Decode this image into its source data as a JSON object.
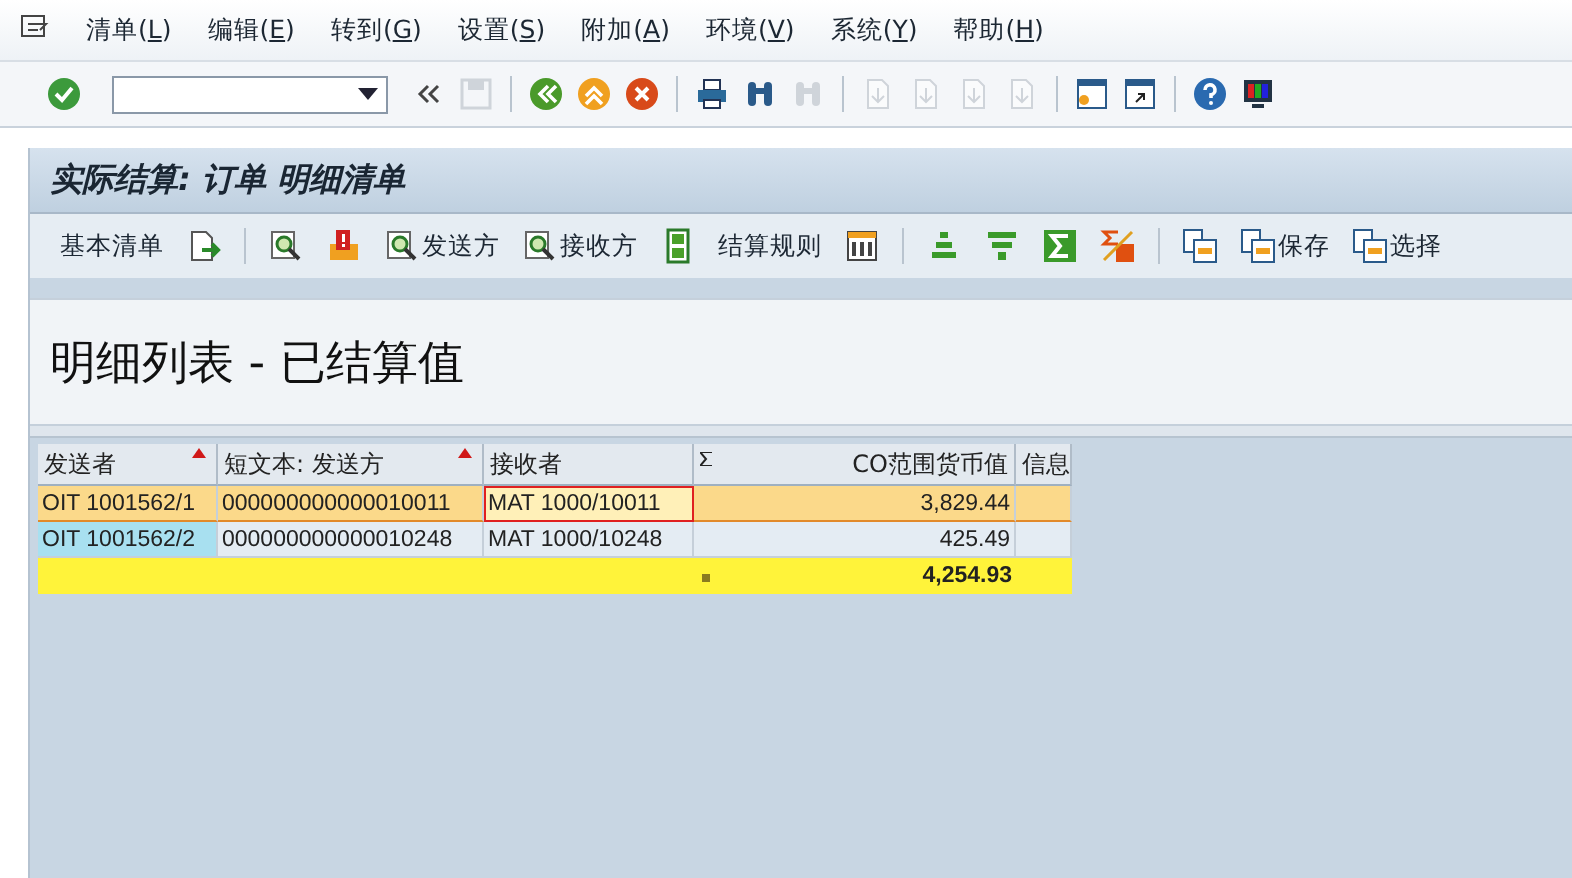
{
  "menu": [
    {
      "label": "清单(",
      "accel": "L",
      "end": ")"
    },
    {
      "label": "编辑(",
      "accel": "E",
      "end": ")"
    },
    {
      "label": "转到(",
      "accel": "G",
      "end": ")"
    },
    {
      "label": "设置(",
      "accel": "S",
      "end": ")"
    },
    {
      "label": "附加(",
      "accel": "A",
      "end": ")"
    },
    {
      "label": "环境(",
      "accel": "V",
      "end": ")"
    },
    {
      "label": "系统(",
      "accel": "Y",
      "end": ")"
    },
    {
      "label": "帮助(",
      "accel": "H",
      "end": ")"
    }
  ],
  "system_toolbar": [
    {
      "kind": "enter",
      "disabled": false
    },
    {
      "kind": "command"
    },
    {
      "kind": "collapse",
      "disabled": false
    },
    {
      "kind": "save",
      "disabled": true
    },
    {
      "kind": "sep"
    },
    {
      "kind": "back",
      "disabled": false
    },
    {
      "kind": "exit",
      "disabled": false
    },
    {
      "kind": "cancel",
      "disabled": false
    },
    {
      "kind": "sep"
    },
    {
      "kind": "print",
      "disabled": false
    },
    {
      "kind": "find",
      "disabled": false
    },
    {
      "kind": "find",
      "disabled": true
    },
    {
      "kind": "sep"
    },
    {
      "kind": "page",
      "disabled": true
    },
    {
      "kind": "page",
      "disabled": true
    },
    {
      "kind": "page",
      "disabled": true
    },
    {
      "kind": "page",
      "disabled": true
    },
    {
      "kind": "sep"
    },
    {
      "kind": "session",
      "disabled": false
    },
    {
      "kind": "shortcut",
      "disabled": false
    },
    {
      "kind": "sep"
    },
    {
      "kind": "help",
      "disabled": false
    },
    {
      "kind": "customize",
      "disabled": false
    }
  ],
  "title": "实际结算: 订单 明细清单",
  "app_toolbar": [
    {
      "kind": "text",
      "label": "基本清单"
    },
    {
      "kind": "export"
    },
    {
      "kind": "sep"
    },
    {
      "kind": "detail"
    },
    {
      "kind": "alert"
    },
    {
      "kind": "detail",
      "label": "发送方"
    },
    {
      "kind": "detail",
      "label": "接收方"
    },
    {
      "kind": "rule"
    },
    {
      "kind": "text",
      "label": "结算规则"
    },
    {
      "kind": "columns"
    },
    {
      "kind": "sep"
    },
    {
      "kind": "sort"
    },
    {
      "kind": "filter"
    },
    {
      "kind": "sum"
    },
    {
      "kind": "subtotal"
    },
    {
      "kind": "sep"
    },
    {
      "kind": "layout"
    },
    {
      "kind": "layout",
      "label": "保存"
    },
    {
      "kind": "layout",
      "label": "选择"
    }
  ],
  "heading": "明细列表 - 已结算值",
  "table": {
    "columns": [
      {
        "label": "发送者",
        "sorted": true,
        "totaled": false,
        "kind": "text"
      },
      {
        "label": "短文本: 发送方",
        "sorted": true,
        "totaled": false,
        "kind": "text"
      },
      {
        "label": "接收者",
        "sorted": false,
        "totaled": false,
        "kind": "text"
      },
      {
        "label": "CO范围货币值",
        "sorted": false,
        "totaled": true,
        "kind": "amount"
      },
      {
        "label": "信息",
        "sorted": false,
        "totaled": false,
        "kind": "text"
      }
    ],
    "rows": [
      {
        "selected": true,
        "cells": [
          {
            "text": "OIT 1001562/1",
            "focused": false
          },
          {
            "text": "000000000000010011",
            "focused": false
          },
          {
            "text": "MAT 1000/10011",
            "focused": true
          },
          {
            "text": "3,829.44",
            "focused": false
          },
          {
            "text": "",
            "focused": false
          }
        ]
      },
      {
        "selected": false,
        "cells": [
          {
            "text": "OIT 1001562/2",
            "focused": false
          },
          {
            "text": "000000000000010248",
            "focused": false
          },
          {
            "text": "MAT 1000/10248",
            "focused": false
          },
          {
            "text": "425.49",
            "focused": false
          },
          {
            "text": "",
            "focused": false
          }
        ]
      }
    ],
    "total": {
      "value": "4,254.93"
    }
  }
}
